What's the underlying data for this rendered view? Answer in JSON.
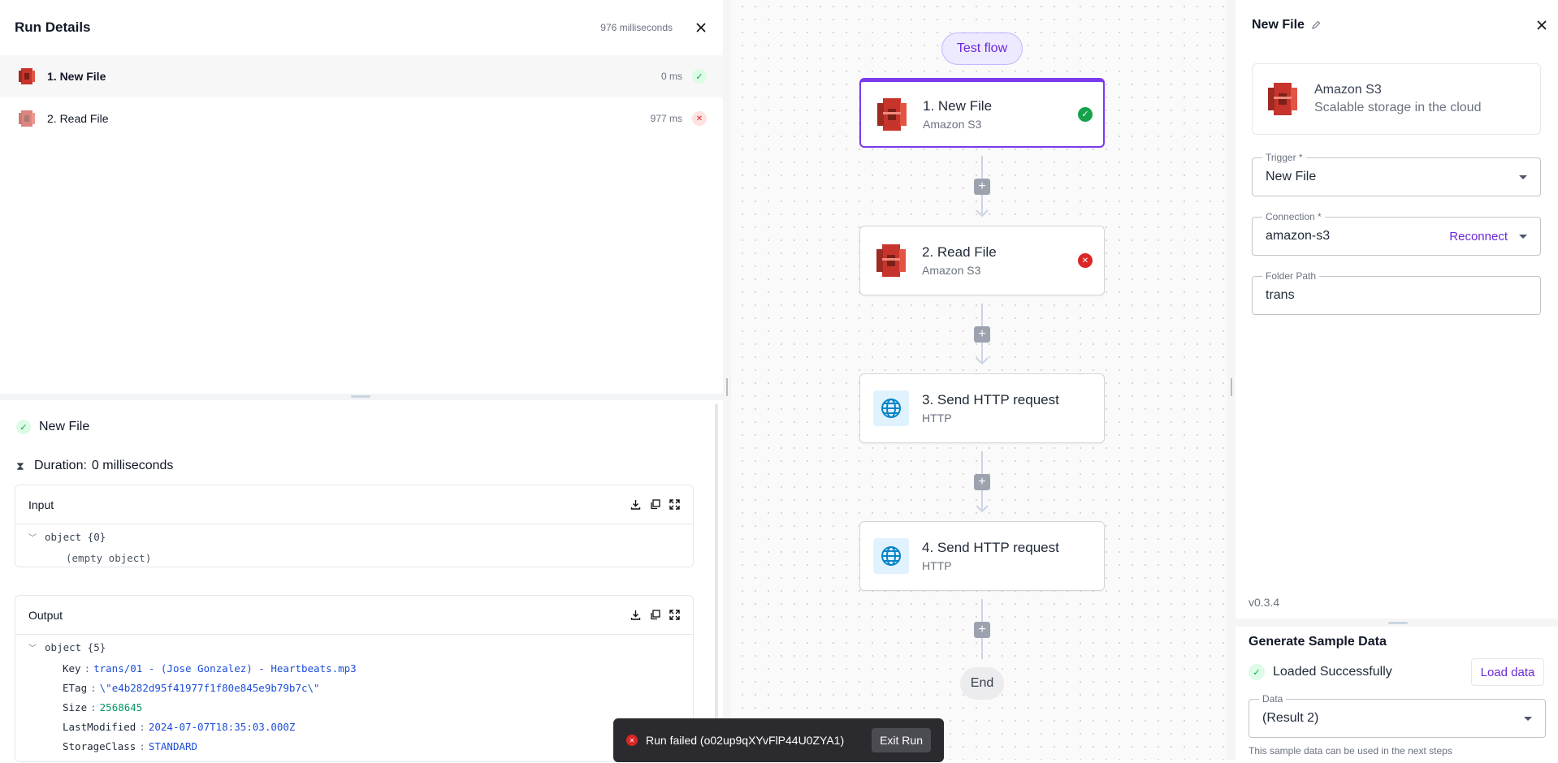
{
  "run_details": {
    "title": "Run Details",
    "total_duration": "976 milliseconds",
    "steps": [
      {
        "label": "1. New File",
        "duration": "0 ms",
        "status": "success"
      },
      {
        "label": "2. Read File",
        "duration": "977 ms",
        "status": "failed"
      }
    ]
  },
  "step_detail": {
    "name": "New File",
    "duration_label": "Duration:",
    "duration_value": "0 milliseconds",
    "input": {
      "title": "Input",
      "root": "object {0}",
      "empty": "(empty object)"
    },
    "output": {
      "title": "Output",
      "root": "object {5}",
      "fields": [
        {
          "key": "Key",
          "value": "trans/01 -  (Jose Gonzalez) - Heartbeats.mp3",
          "kind": "string"
        },
        {
          "key": "ETag",
          "value": "\\\"e4b282d95f41977f1f80e845e9b79b7c\\\"",
          "kind": "string"
        },
        {
          "key": "Size",
          "value": "2568645",
          "kind": "number"
        },
        {
          "key": "LastModified",
          "value": "2024-07-07T18:35:03.000Z",
          "kind": "string"
        },
        {
          "key": "StorageClass",
          "value": "STANDARD",
          "kind": "string"
        }
      ]
    }
  },
  "canvas": {
    "test_flow": "Test flow",
    "nodes": [
      {
        "title": "1. New File",
        "subtitle": "Amazon S3",
        "icon": "amazon-s3-icon",
        "status": "success"
      },
      {
        "title": "2. Read File",
        "subtitle": "Amazon S3",
        "icon": "amazon-s3-icon",
        "status": "failed"
      },
      {
        "title": "3. Send HTTP request",
        "subtitle": "HTTP",
        "icon": "globe-icon",
        "status": "none"
      },
      {
        "title": "4. Send HTTP request",
        "subtitle": "HTTP",
        "icon": "globe-icon",
        "status": "none"
      }
    ],
    "end_label": "End"
  },
  "toast": {
    "message": "Run failed (o02up9qXYvFlP44U0ZYA1)",
    "button": "Exit Run"
  },
  "step_settings": {
    "title": "New File",
    "piece_name": "Amazon S3",
    "piece_description": "Scalable storage in the cloud",
    "trigger": {
      "label": "Trigger *",
      "value": "New File"
    },
    "connection": {
      "label": "Connection *",
      "value": "amazon-s3",
      "action": "Reconnect"
    },
    "folder_path": {
      "label": "Folder Path",
      "value": "trans"
    },
    "version": "v0.3.4"
  },
  "sample_data": {
    "title": "Generate Sample Data",
    "status": "Loaded Successfully",
    "button": "Load data",
    "data_label": "Data",
    "data_value": "(Result 2)",
    "note": "This sample data can be used in the next steps"
  },
  "colors": {
    "accent": "#7c3aed",
    "success": "#16a34a",
    "error": "#dc2626",
    "s3_red": "#d63a2f"
  }
}
